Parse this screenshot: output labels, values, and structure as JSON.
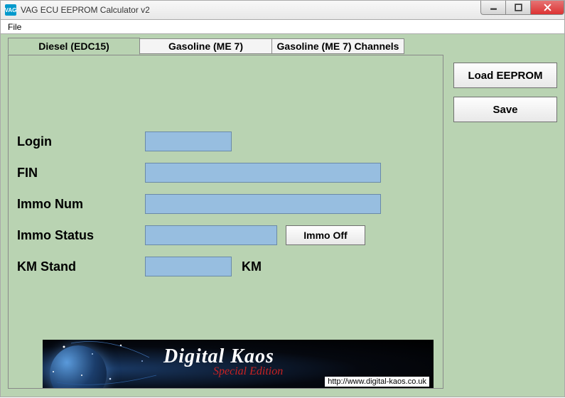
{
  "window": {
    "title": "VAG ECU EEPROM Calculator v2",
    "icon_text": "VAG"
  },
  "menu": {
    "file": "File"
  },
  "tabs": [
    {
      "label": "Diesel (EDC15)",
      "active": true
    },
    {
      "label": "Gasoline (ME 7)",
      "active": false
    },
    {
      "label": "Gasoline (ME 7) Channels",
      "active": false
    }
  ],
  "form": {
    "login_label": "Login",
    "login_value": "",
    "fin_label": "FIN",
    "fin_value": "",
    "immonum_label": "Immo Num",
    "immonum_value": "",
    "immostatus_label": "Immo Status",
    "immostatus_value": "",
    "immo_off_btn": "Immo Off",
    "kmstand_label": "KM Stand",
    "kmstand_value": "",
    "km_unit": "KM"
  },
  "sidebar": {
    "load_btn": "Load EEPROM",
    "save_btn": "Save"
  },
  "banner": {
    "main": "Digital Kaos",
    "sub": "Special Edition",
    "url": "http://www.digital-kaos.co.uk"
  }
}
